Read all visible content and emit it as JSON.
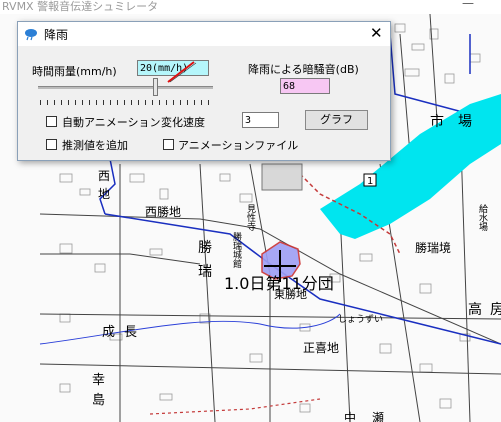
{
  "app": {
    "title": "RVMX 警報音伝達シュミレータ",
    "minimize_symbol": "—"
  },
  "dialog": {
    "title": "降雨",
    "close_symbol": "✕",
    "rainfall_label": "時間雨量(mm/h)",
    "rainfall_value": "20(mm/h)",
    "noise_label": "降雨による暗騒音(dB)",
    "noise_value": "68",
    "auto_anim_label": "自動アニメーション",
    "change_speed_label": "変化速度",
    "speed_value": "3",
    "graph_button": "グラフ",
    "add_estimate_label": "推測値を追加",
    "anim_file_label": "アニメーションファイル"
  },
  "map_labels": {
    "nishi": "西",
    "chi": "地",
    "nishi_katsuchi": "西勝地",
    "kenshoji": "見性寺",
    "shoz": "勝",
    "zui": "瑞",
    "katsumizujo": "勝瑞城館",
    "shijo": "市",
    "ba": "場",
    "katsumizu_sakai": "勝瑞境",
    "taka": "高",
    "ho": "房",
    "time_label": "1.0日第11分団",
    "higashi_katsuchi": "東勝地",
    "seicho": "成",
    "naga": "長",
    "shozui": "しょうずい",
    "seikichi": "正喜地",
    "kou": "幸",
    "shima": "島",
    "naka": "中",
    "se": "瀬",
    "route_no": "1",
    "kyusui": "給水場"
  }
}
